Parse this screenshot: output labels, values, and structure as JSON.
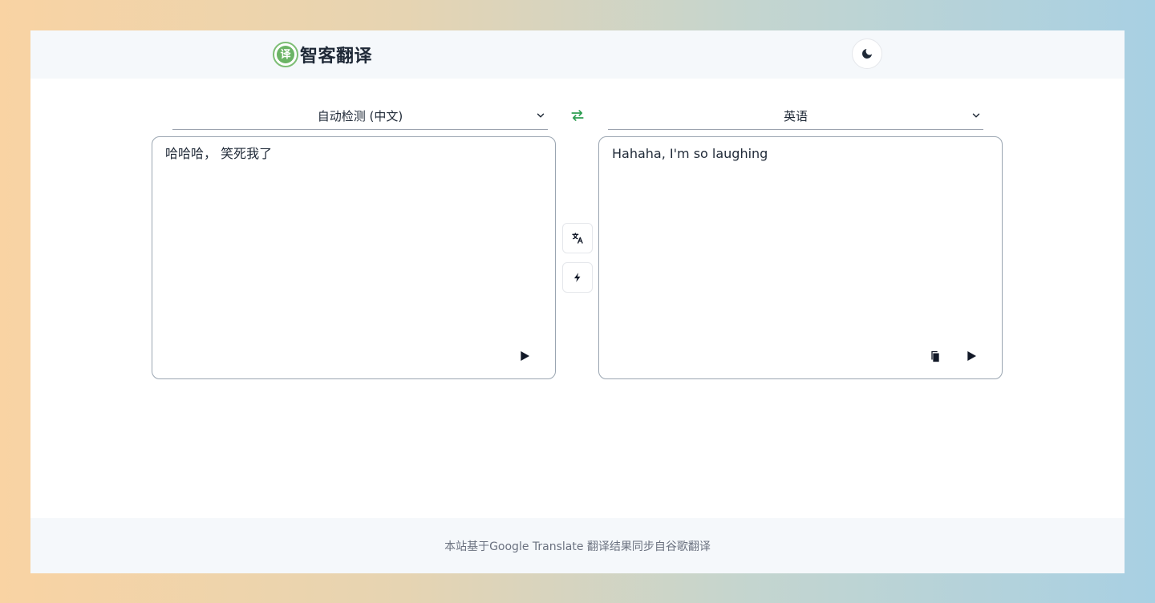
{
  "header": {
    "logo_char": "译",
    "brand_name": "智客翻译",
    "theme_toggle_icon": "moon-icon"
  },
  "languages": {
    "source": "自动检测 (中文)",
    "target": "英语",
    "swap_icon": "swap-arrows-icon",
    "accent_color": "#2e9e52"
  },
  "source_panel": {
    "text": "哈哈哈， 笑死我了",
    "actions": [
      "play-icon"
    ]
  },
  "target_panel": {
    "text": "Hahaha, I'm so laughing",
    "actions": [
      "copy-icon",
      "play-icon"
    ]
  },
  "side_actions": [
    "translate-icon",
    "lightning-icon"
  ],
  "footer": {
    "text": "本站基于Google Translate 翻译结果同步自谷歌翻译"
  }
}
